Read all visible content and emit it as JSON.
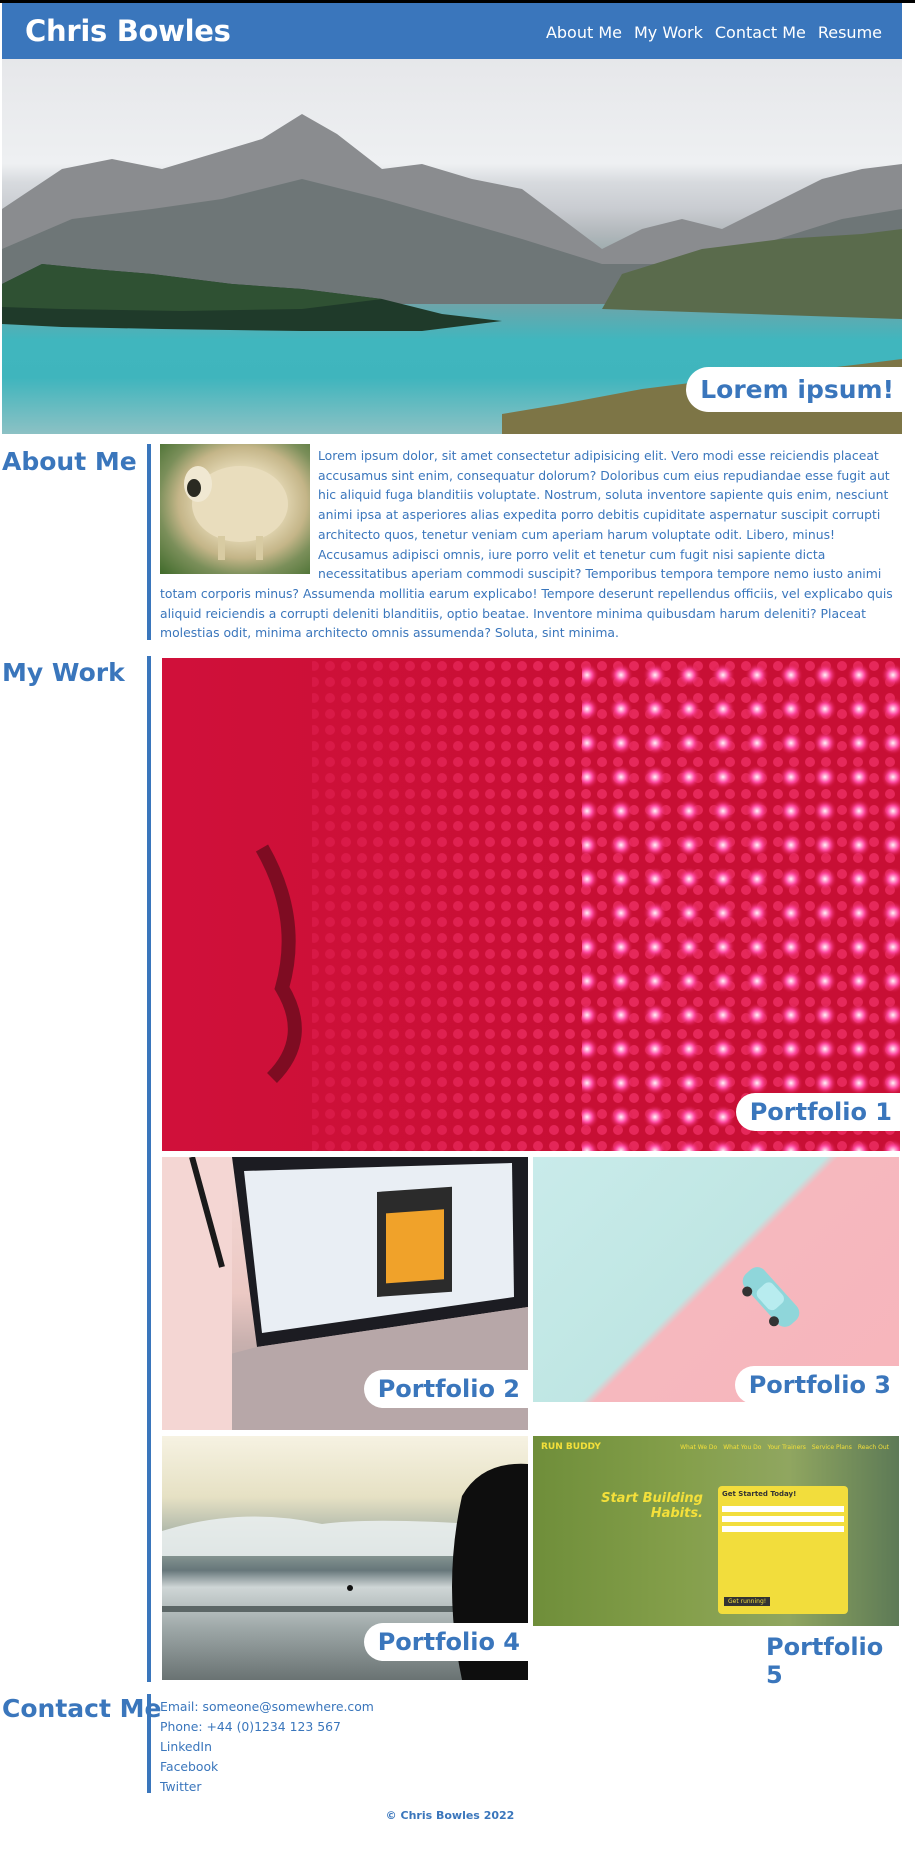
{
  "header": {
    "brand": "Chris Bowles",
    "nav": [
      "About Me",
      "My Work",
      "Contact Me",
      "Resume"
    ]
  },
  "hero": {
    "tagline": "Lorem ipsum!"
  },
  "about": {
    "title": "About Me",
    "text": "Lorem ipsum dolor, sit amet consectetur adipisicing elit. Vero modi esse reiciendis placeat accusamus sint enim, consequatur dolorum? Doloribus cum eius repudiandae esse fugit aut hic aliquid fuga blanditiis voluptate. Nostrum, soluta inventore sapiente quis enim, nesciunt animi ipsa at asperiores alias expedita porro debitis cupiditate aspernatur suscipit corrupti architecto quos, tenetur veniam cum aperiam harum voluptate odit. Libero, minus! Accusamus adipisci omnis, iure porro velit et tenetur cum fugit nisi sapiente dicta necessitatibus aperiam commodi suscipit? Temporibus tempora tempore nemo iusto animi totam corporis minus? Assumenda mollitia earum explicabo! Tempore deserunt repellendus officiis, vel explicabo quis aliquid reiciendis a corrupti deleniti blanditiis, optio beatae. Inventore minima quibusdam harum deleniti? Placeat molestias odit, minima architecto omnis assumenda? Soluta, sint minima."
  },
  "work": {
    "title": "My Work",
    "items": [
      "Portfolio 1",
      "Portfolio 2",
      "Portfolio 3",
      "Portfolio 4",
      "Portfolio 5"
    ],
    "p5_screenshot": {
      "brand": "RUN BUDDY",
      "nav": [
        "What We Do",
        "What You Do",
        "Your Trainers",
        "Service Plans",
        "Reach Out"
      ],
      "headline": "Start Building Habits.",
      "form_title": "Get Started Today!",
      "submit": "Get running!"
    }
  },
  "contact": {
    "title": "Contact Me",
    "email": "Email: someone@somewhere.com",
    "phone": "Phone: +44 (0)1234 123 567",
    "links": [
      "LinkedIn",
      "Facebook",
      "Twitter"
    ]
  },
  "footer": {
    "copyright": "© Chris Bowles 2022"
  },
  "colors": {
    "accent": "#3a76bc",
    "background": "#ffffff"
  }
}
